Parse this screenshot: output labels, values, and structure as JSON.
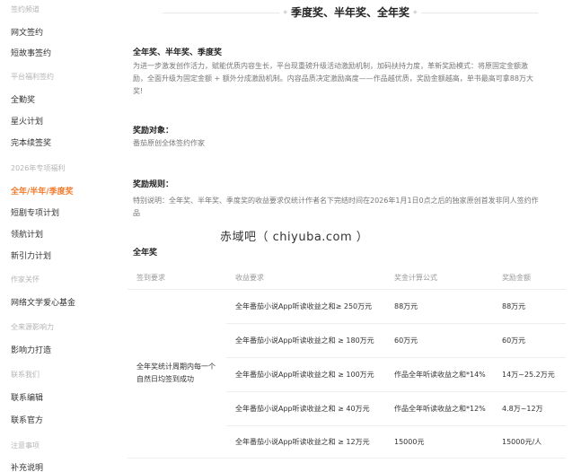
{
  "sidebar": {
    "groups": {
      "g1": "签约频道",
      "g2": "平台福利签约",
      "g3": "2026年专项福利",
      "g4": "作家关怀",
      "g5": "全来源影响力",
      "g6": "联系我们",
      "g7": "注意事项"
    },
    "items": {
      "i1": "网文签约",
      "i2": "短故事签约",
      "i3": "全勤奖",
      "i4": "星火计划",
      "i5": "完本续签奖",
      "i6": "全年/半年/季度奖",
      "i7": "短剧专项计划",
      "i8": "领航计划",
      "i9": "新引力计划",
      "i10": "网络文学爱心基金",
      "i11": "影响力打造",
      "i12": "联系编辑",
      "i13": "联系官方",
      "i14": "补充说明"
    }
  },
  "main": {
    "title": "季度奖、半年奖、全年奖",
    "section1_title": "全年奖、半年奖、季度奖",
    "section1_line1": "为进一步激发创作活力，赋能优质内容生长，平台现重磅升级活动激励机制，加码扶持力度，革新奖励模式：将原固定金额激",
    "section1_line2": "励，全面升级为固定金额 + 额外分成激励机制。内容品质决定激励高度——作品越优质，奖励金额越高，单书最高可拿88万大",
    "section1_line3": "奖!",
    "target_title": "奖励对象：",
    "target_text": "番茄原创全体签约作家",
    "rules_title": "奖励规则：",
    "rules_line1": "特别说明：全年奖、半年奖、季度奖的收益要求仅统计作者名下完结时间在2026年1月1日0点之后的独家原创首发非同人签约作",
    "rules_line2": "品",
    "annual_title": "全年奖",
    "watermark": "赤域吧（ chiyuba.com ）"
  },
  "table": {
    "headers": [
      "签到要求",
      "收益要求",
      "奖金计算公式",
      "奖励金额"
    ],
    "merged_line1": "全年奖统计周期内每一个",
    "merged_line2": "自然日均签到成功",
    "rows": [
      {
        "req": "全年番茄小说App听读收益之和≥ 250万元",
        "formula": "88万元",
        "amount": "88万元"
      },
      {
        "req": "全年番茄小说App听读收益之和 ≥ 180万元",
        "formula": "60万元",
        "amount": "60万元"
      },
      {
        "req": "全年番茄小说App听读收益之和 ≥ 100万元",
        "formula": "作品全年听读收益之和*14%",
        "amount": "14万~25.2万元"
      },
      {
        "req": "全年番茄小说App听读收益之和 ≥ 40万元",
        "formula": "作品全年听读收益之和*12%",
        "amount": "4.8万~12万"
      },
      {
        "req": "全年番茄小说App听读收益之和 ≥ 12万元",
        "formula": "15000元",
        "amount": "15000元/人"
      }
    ]
  },
  "colors": {
    "accent": "#f27b2c"
  }
}
